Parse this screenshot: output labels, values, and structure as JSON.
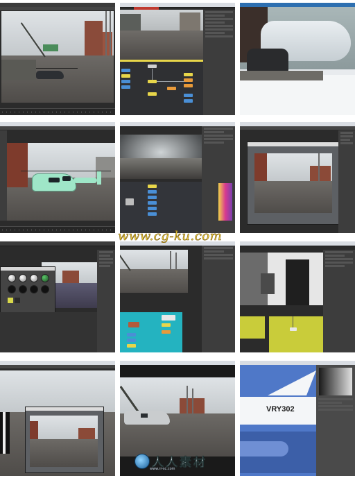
{
  "tiles": [
    {
      "id": "t1",
      "desc_ui": "viewport-helicopter-street"
    },
    {
      "id": "t2",
      "desc_ui": "node-editor-street"
    },
    {
      "id": "t3",
      "desc_ui": "closeup-chrome-render"
    },
    {
      "id": "t4",
      "desc_ui": "green-helicopter-model"
    },
    {
      "id": "t5",
      "desc_ui": "hdri-node-graph"
    },
    {
      "id": "t6",
      "desc_ui": "render-view-window"
    },
    {
      "id": "t7",
      "desc_ui": "material-spheres-dialog"
    },
    {
      "id": "t8",
      "desc_ui": "cyan-node-graph"
    },
    {
      "id": "t9",
      "desc_ui": "interior-lookdev"
    },
    {
      "id": "t10",
      "desc_ui": "nested-render-windows"
    },
    {
      "id": "t11",
      "desc_ui": "helicopter-composite"
    },
    {
      "id": "t12",
      "desc_ui": "aircraft-closeup"
    }
  ],
  "watermark": {
    "url": "www.cg-ku.com",
    "brand": "人人素材",
    "brand_url": "www.rr-sc.com"
  },
  "aircraft": {
    "registration": "VRY302"
  },
  "colors": {
    "window_dark": "#2b2b2b",
    "node_yellow": "#e8d64a",
    "node_orange": "#e89a3a",
    "node_blue": "#4a8fd6",
    "teal_bg": "#24b3c0",
    "lime_bg": "#c9cc3a",
    "heli_green": "#9fe6c8",
    "plane_blue": "#4f78c8"
  }
}
